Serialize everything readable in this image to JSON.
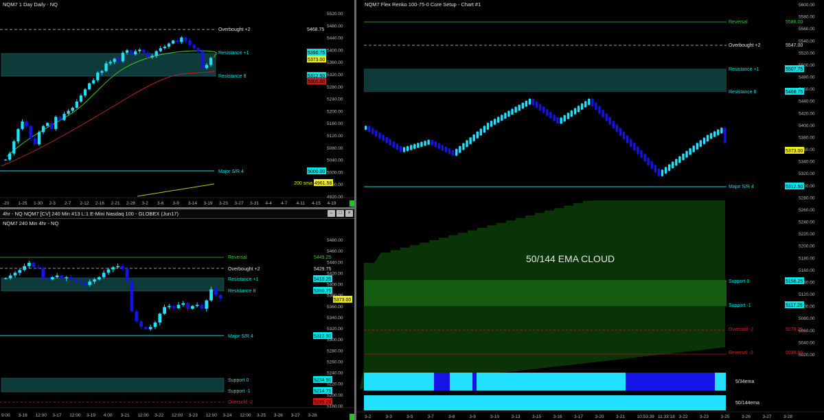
{
  "daily": {
    "title": "NQM7 1 Day  Daily - NQ",
    "levels": [
      {
        "name": "overbought",
        "label": "Overbought +2",
        "value": "5468.75",
        "color": "#e6e6e6"
      },
      {
        "name": "resistance-plus1",
        "label": "Resistance +1",
        "value": "5390.75",
        "color": "#00e5e5"
      },
      {
        "name": "resistance-8",
        "label": "Resistance 8",
        "value": "5312.50",
        "color": "#00e5e5"
      },
      {
        "name": "major-sr4",
        "label": "Major S/R 4",
        "value": "5000.00",
        "color": "#00e5e5"
      },
      {
        "name": "sma200",
        "label": "200 sma",
        "value": "4961.58",
        "color": "#e6e600"
      }
    ],
    "price_tag": "5373.00",
    "red_tag": "5300.00",
    "axis": [
      "5520.00",
      "5480.00",
      "5440.00",
      "5400.00",
      "5360.00",
      "5320.00",
      "5280.00",
      "5240.00",
      "5200.00",
      "5160.00",
      "5120.00",
      "5080.00",
      "5040.00",
      "5000.00",
      "4960.00",
      "4920.00"
    ],
    "dates": [
      "-20",
      "1-25",
      "1-30",
      "2-3",
      "2-7",
      "2-12",
      "2-16",
      "2-21",
      "2-28",
      "3-2",
      "3-6",
      "3-9",
      "3-14",
      "3-19",
      "3-23",
      "3-27",
      "3-31",
      "4-4",
      "4-7",
      "4-11",
      "4-15",
      "4-19"
    ]
  },
  "h4": {
    "title": "4hr - NQ  NQM7 [CV]  240 Min   #13  L:1  E-Mini Nasdaq 100 - GLOBEX (Jun17)",
    "subtitle": "NQM7 240 Min  4hr - NQ",
    "levels": [
      {
        "name": "reversal",
        "label": "Reversal",
        "value": "5449.25",
        "color": "#2fd02f"
      },
      {
        "name": "overbought",
        "label": "Overbought +2",
        "value": "5429.75",
        "color": "#e6e6e6"
      },
      {
        "name": "resistance-plus1",
        "label": "Resistance +1",
        "value": "5410.25",
        "color": "#00e5e5"
      },
      {
        "name": "resistance-8",
        "label": "Resistance 8",
        "value": "5390.75",
        "color": "#00e5e5"
      },
      {
        "name": "major-sr4",
        "label": "Major S/R 4",
        "value": "5312.50",
        "color": "#00e5e5"
      },
      {
        "name": "support-0",
        "label": "Support 0",
        "value": "5234.50",
        "color": "#00e5e5"
      },
      {
        "name": "support-minus1",
        "label": "Support -1",
        "value": "5214.75",
        "color": "#00e5e5"
      },
      {
        "name": "oversold",
        "label": "Oversold -2",
        "value": "5195.25",
        "color": "#e02020"
      }
    ],
    "price_tag": "5373.00",
    "axis": [
      "5480.00",
      "5460.00",
      "5440.00",
      "5420.00",
      "5400.00",
      "5380.00",
      "5360.00",
      "5340.00",
      "5320.00",
      "5300.00",
      "5280.00",
      "5260.00",
      "5240.00",
      "5220.00",
      "5200.00",
      "5180.00"
    ],
    "dates": [
      "9:00",
      "3-16",
      "12:00",
      "3-17",
      "12:00",
      "3-19",
      "4:00",
      "3-21",
      "12:00",
      "3-22",
      "12:00",
      "3-23",
      "12:00",
      "3-24",
      "12:00",
      "3-25",
      "3-26",
      "3-27",
      "3-28"
    ]
  },
  "renko": {
    "title": "NQM7 Flex Renko 100-75-0 Core Setup - Chart #1",
    "levels": [
      {
        "name": "reversal",
        "label": "Reversal",
        "value": "5586.00",
        "color": "#2fd02f"
      },
      {
        "name": "overbought",
        "label": "Overbought +2",
        "value": "5547.00",
        "color": "#e6e6e6"
      },
      {
        "name": "resistance-plus1",
        "label": "Resistance +1",
        "value": "5507.75",
        "color": "#00e5e5"
      },
      {
        "name": "resistance-8",
        "label": "Resistance 8",
        "value": "5468.75",
        "color": "#00e5e5"
      },
      {
        "name": "major-sr4",
        "label": "Major S/R 4",
        "value": "5312.50",
        "color": "#00e5e5"
      },
      {
        "name": "support-0",
        "label": "Support 0",
        "value": "5156.25",
        "color": "#00e5e5"
      },
      {
        "name": "support-minus1",
        "label": "Support -1",
        "value": "5117.25",
        "color": "#00e5e5"
      },
      {
        "name": "oversold",
        "label": "Oversold -2",
        "value": "5078.25",
        "color": "#e02020"
      },
      {
        "name": "reversal-minus3",
        "label": "Reversal -3",
        "value": "5039.00",
        "color": "#e02020"
      }
    ],
    "price_tag": "5373.00",
    "cloud_label": "50/144 EMA CLOUD",
    "ema_strip1_label": "5/34ema",
    "ema_strip2_label": "50/144ema",
    "axis": [
      "5600.00",
      "5580.00",
      "5560.00",
      "5540.00",
      "5520.00",
      "5500.00",
      "5480.00",
      "5460.00",
      "5440.00",
      "5420.00",
      "5400.00",
      "5380.00",
      "5360.00",
      "5340.00",
      "5320.00",
      "5300.00",
      "5280.00",
      "5260.00",
      "5240.00",
      "5220.00",
      "5200.00",
      "5180.00",
      "5160.00",
      "5140.00",
      "5120.00",
      "5100.00",
      "5080.00",
      "5060.00",
      "5040.00",
      "5020.00"
    ],
    "dates": [
      "3-2",
      "3-3",
      "3-5",
      "3-7",
      "3-8",
      "3-9",
      "3-10",
      "3-13",
      "3-15",
      "3-16",
      "3-17",
      "3-20",
      "3-21",
      "10:53:39",
      "11:33:18",
      "3-22",
      "3-23",
      "3-25",
      "3-26",
      "3-27",
      "3-28"
    ]
  },
  "colors": {
    "bull": "#22e0ff",
    "bear": "#1414e6",
    "cyan": "#00e5e5",
    "zone": "#0f3a3a",
    "cloud_dark": "#0a3308",
    "cloud_light": "#145c10",
    "ema_fast": "#3fd02a",
    "ema_slow": "#c4241c",
    "sma200": "#c6c61c"
  }
}
